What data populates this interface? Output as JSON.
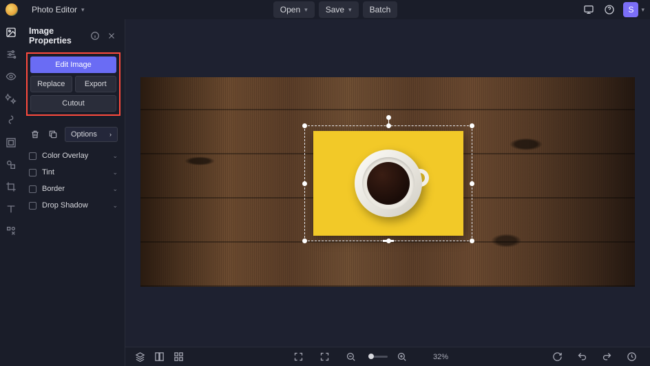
{
  "app": {
    "title": "Photo Editor"
  },
  "topbar": {
    "open": "Open",
    "save": "Save",
    "batch": "Batch",
    "avatar_initial": "S"
  },
  "panel": {
    "title": "Image Properties",
    "edit_image": "Edit Image",
    "replace": "Replace",
    "export": "Export",
    "cutout": "Cutout",
    "options": "Options",
    "sections": [
      {
        "label": "Color Overlay"
      },
      {
        "label": "Tint"
      },
      {
        "label": "Border"
      },
      {
        "label": "Drop Shadow"
      }
    ]
  },
  "footer": {
    "zoom": "32%"
  },
  "colors": {
    "highlight": "#ff4b3e",
    "primary": "#6a6cf4"
  }
}
